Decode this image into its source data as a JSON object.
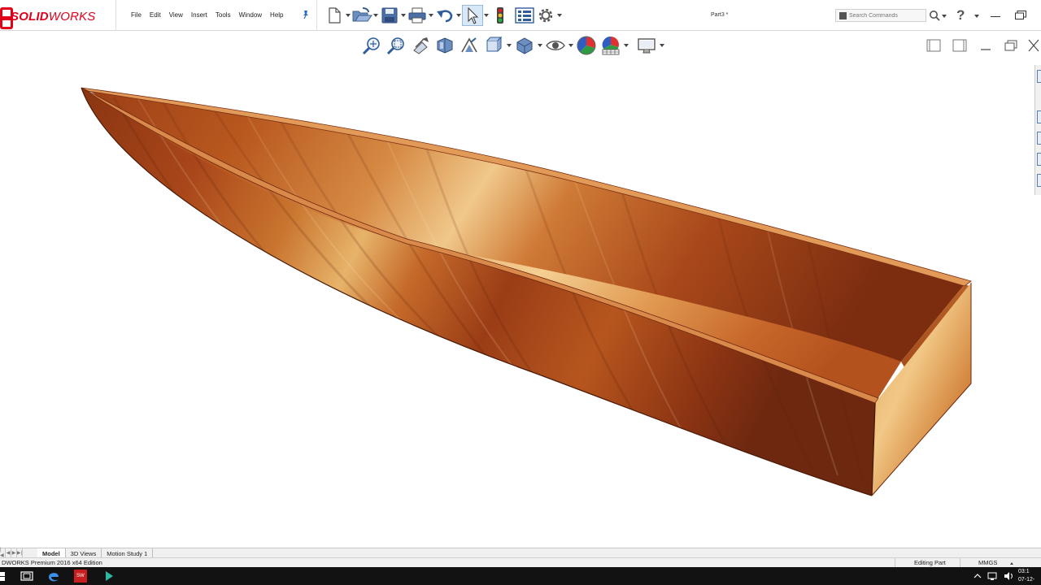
{
  "app": {
    "logo_text_bold": "SOLID",
    "logo_text_light": "WORKS",
    "document_title": "Part3 *"
  },
  "menu": {
    "items": [
      "File",
      "Edit",
      "View",
      "Insert",
      "Tools",
      "Window",
      "Help"
    ]
  },
  "toolbar": {
    "buttons": [
      "new-icon",
      "open-icon",
      "save-icon",
      "print-icon",
      "undo-icon",
      "select-icon",
      "rebuild-icon",
      "file-properties-icon",
      "options-icon"
    ]
  },
  "search": {
    "placeholder": "Search Commands"
  },
  "heads_up_toolbar": {
    "buttons": [
      "zoom-to-fit-icon",
      "zoom-to-area-icon",
      "previous-view-icon",
      "section-view-icon",
      "dynamic-annotation-icon",
      "view-orientation-icon",
      "display-style-icon",
      "hide-show-items-icon",
      "edit-appearance-icon",
      "apply-scene-icon",
      "view-settings-icon"
    ]
  },
  "model": {
    "description": "wooden boat hull",
    "colors": {
      "wood_dark": "#7a2e12",
      "wood_mid": "#b8561f",
      "wood_light": "#e8b46a",
      "rim": "#d98a4a"
    }
  },
  "tabs": {
    "items": [
      "Model",
      "3D Views",
      "Motion Study 1"
    ],
    "active": "Model"
  },
  "status": {
    "edition": "DWORKS Premium 2016 x64 Edition",
    "mode": "Editing Part",
    "units": "MMGS"
  },
  "clock": {
    "time": "03:1",
    "date": "07-12-"
  },
  "theme": {
    "accent": "#e1001a",
    "selected_bg": "#d9e8f6"
  }
}
